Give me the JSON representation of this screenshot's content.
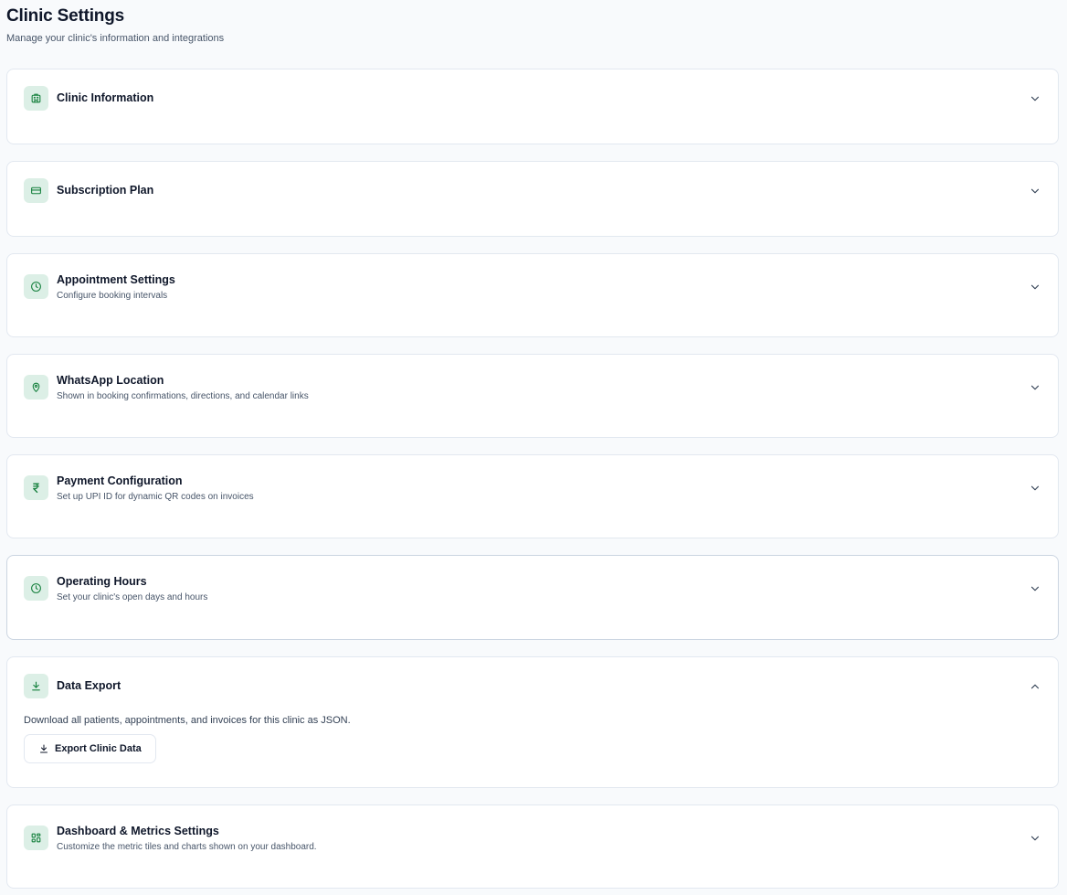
{
  "page": {
    "title": "Clinic Settings",
    "subtitle": "Manage your clinic's information and integrations"
  },
  "sections": [
    {
      "key": "clinic-information",
      "title": "Clinic Information",
      "description": "",
      "icon": "building-icon",
      "expanded": false
    },
    {
      "key": "subscription-plan",
      "title": "Subscription Plan",
      "description": "",
      "icon": "credit-card-icon",
      "expanded": false
    },
    {
      "key": "appointment-settings",
      "title": "Appointment Settings",
      "description": "Configure booking intervals",
      "icon": "clock-icon",
      "expanded": false
    },
    {
      "key": "whatsapp-location",
      "title": "WhatsApp Location",
      "description": "Shown in booking confirmations, directions, and calendar links",
      "icon": "map-pin-icon",
      "expanded": false
    },
    {
      "key": "payment-configuration",
      "title": "Payment Configuration",
      "description": "Set up UPI ID for dynamic QR codes on invoices",
      "icon": "rupee-icon",
      "expanded": false
    },
    {
      "key": "operating-hours",
      "title": "Operating Hours",
      "description": "Set your clinic's open days and hours",
      "icon": "clock-icon",
      "expanded": false
    },
    {
      "key": "data-export",
      "title": "Data Export",
      "description": "",
      "icon": "download-icon",
      "expanded": true
    },
    {
      "key": "dashboard-metrics",
      "title": "Dashboard & Metrics Settings",
      "description": "Customize the metric tiles and charts shown on your dashboard.",
      "icon": "layout-grid-icon",
      "expanded": false
    }
  ],
  "data_export": {
    "description": "Download all patients, appointments, and invoices for this clinic as JSON.",
    "button_label": "Export Clinic Data"
  },
  "colors": {
    "accent": "#15803d",
    "icon_bg": "#dcefe6",
    "page_bg": "#f8fafc",
    "card_border": "#e2e8f0"
  }
}
